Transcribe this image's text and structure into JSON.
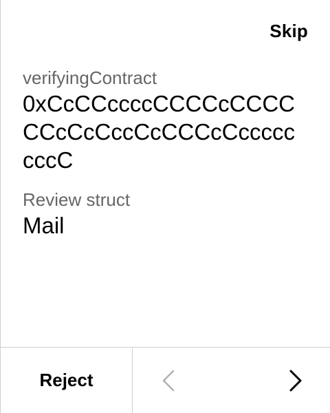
{
  "header": {
    "skip_label": "Skip"
  },
  "fields": [
    {
      "label": "verifyingContract",
      "value": "0xCcCCccccCCCCcCCCCCCcCcCccCcCCCcCccccccccC"
    },
    {
      "label": "Review struct",
      "value": "Mail"
    }
  ],
  "footer": {
    "reject_label": "Reject",
    "prev_icon": "chevron-left-icon",
    "next_icon": "chevron-right-icon",
    "prev_color": "#b0b0b0",
    "next_color": "#000000"
  }
}
